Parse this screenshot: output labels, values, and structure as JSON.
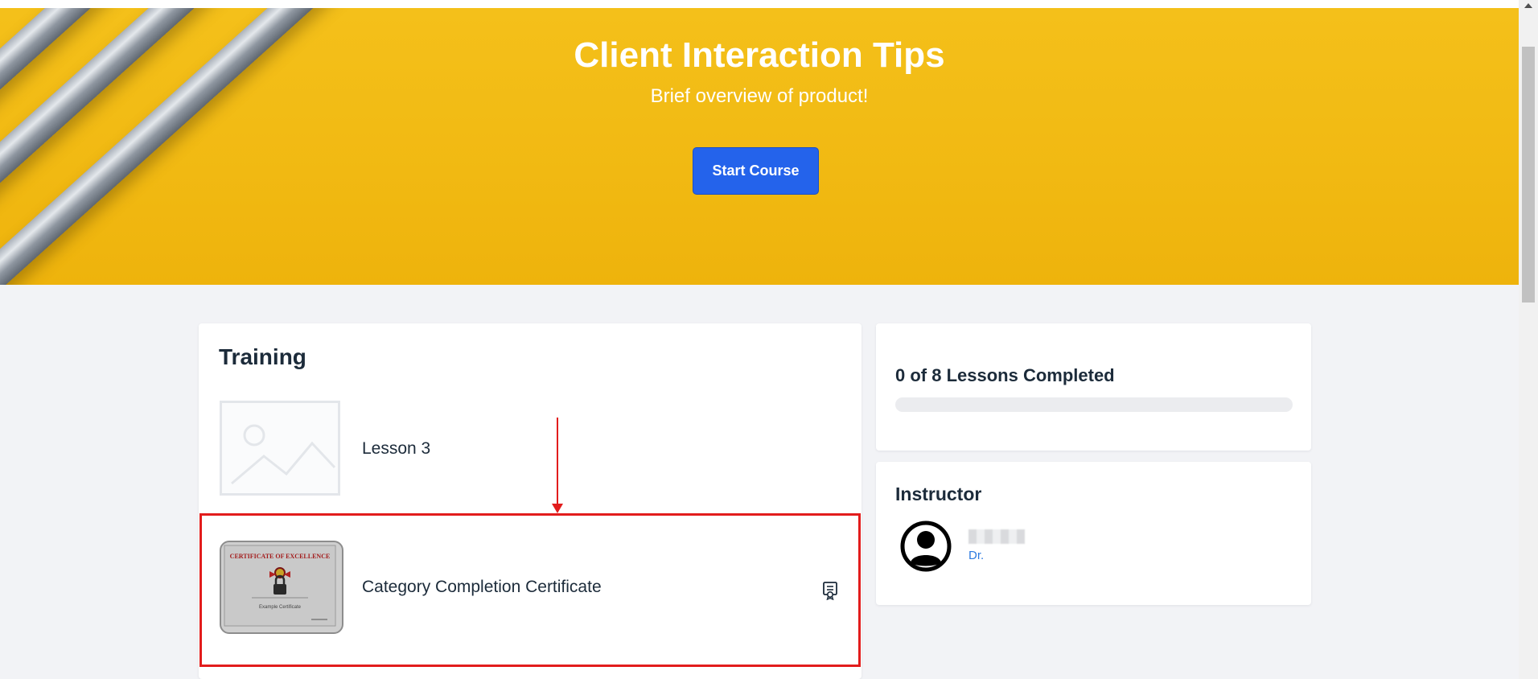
{
  "hero": {
    "title": "Client Interaction Tips",
    "subtitle": "Brief overview of product!",
    "start_button": "Start Course"
  },
  "training": {
    "title": "Training",
    "lessons": [
      {
        "label": "Lesson 3",
        "thumbnail": "image-placeholder-icon"
      },
      {
        "label": "Category Completion Certificate",
        "thumbnail": "certificate-thumbnail",
        "thumb_text": {
          "heading": "CERTIFICATE OF EXCELLENCE",
          "name": "Example Certificate"
        },
        "trailing_icon": "certificate-icon"
      }
    ]
  },
  "progress": {
    "label": "0 of 8 Lessons Completed",
    "completed": 0,
    "total": 8
  },
  "instructor": {
    "title": "Instructor",
    "prefix": "Dr."
  },
  "colors": {
    "hero_background": "#f2ba12",
    "primary_button": "#2463eb",
    "annotation_red": "#e21c1c",
    "link_blue": "#2d7be0"
  }
}
